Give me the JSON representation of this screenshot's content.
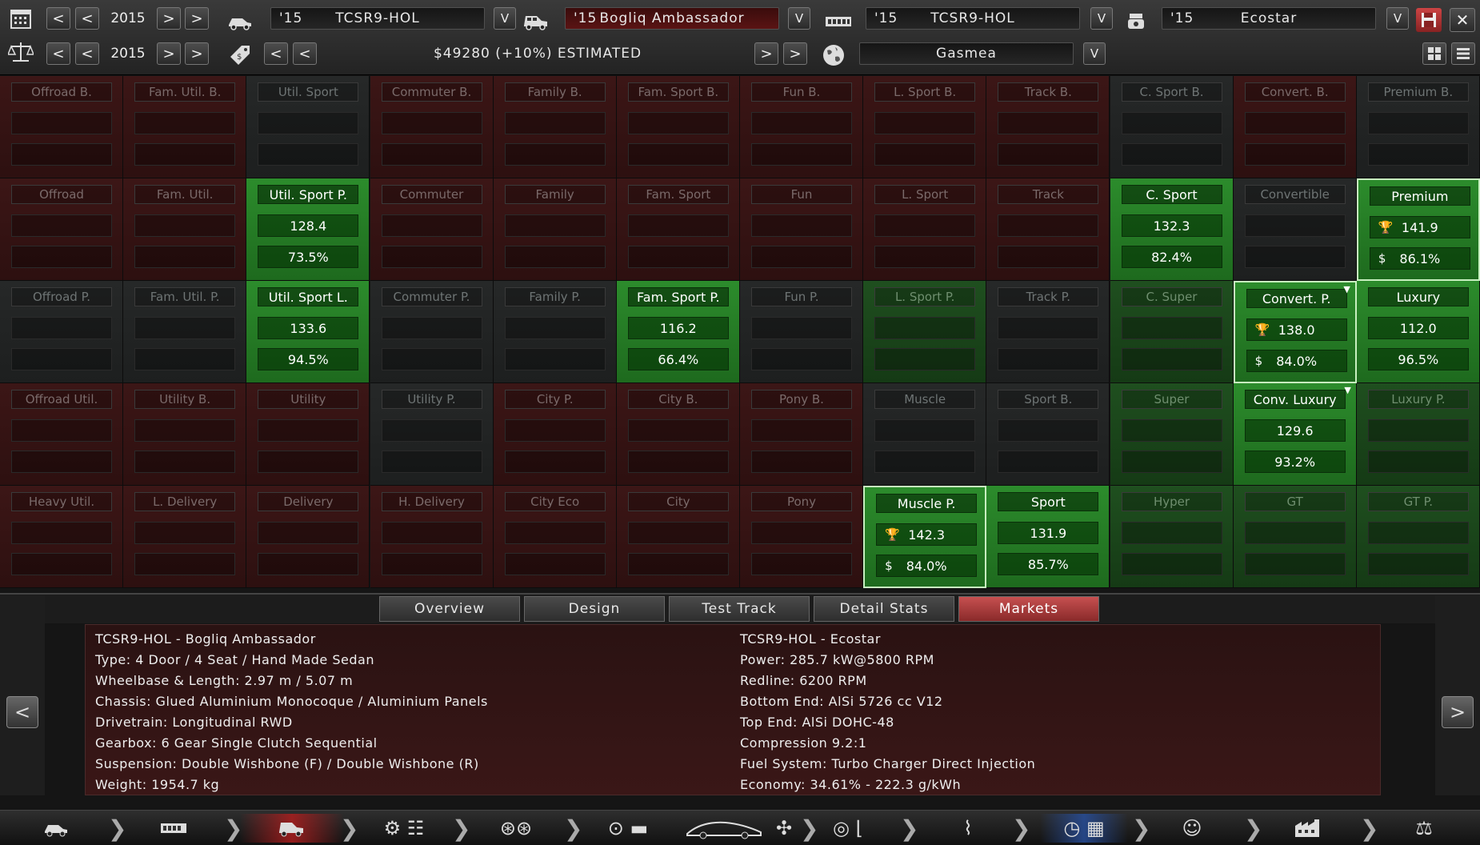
{
  "top": {
    "row1": {
      "year": "2015",
      "body": {
        "prefix": "'15",
        "name": "TCSR9-HOL"
      },
      "model": {
        "prefix": "'15",
        "name": "Bogliq Ambassador"
      },
      "engine": {
        "prefix": "'15",
        "name": "TCSR9-HOL"
      },
      "variant": {
        "prefix": "'15",
        "name": "Ecostar"
      }
    },
    "row2": {
      "year": "2015",
      "price": "$49280 (+10%) ESTIMATED",
      "country": "Gasmea"
    },
    "dropdown_glyph": "V",
    "left_glyph": "<",
    "right_glyph": ">"
  },
  "markets": [
    [
      {
        "label": "Offroad B.",
        "s": "r"
      },
      {
        "label": "Fam. Util. B.",
        "s": "r"
      },
      {
        "label": "Util. Sport",
        "s": "n"
      },
      {
        "label": "Commuter B.",
        "s": "r"
      },
      {
        "label": "Family B.",
        "s": "r"
      },
      {
        "label": "Fam. Sport B.",
        "s": "r"
      },
      {
        "label": "Fun B.",
        "s": "r"
      },
      {
        "label": "L. Sport B.",
        "s": "r"
      },
      {
        "label": "Track B.",
        "s": "r"
      },
      {
        "label": "C. Sport B.",
        "s": "n"
      },
      {
        "label": "Convert. B.",
        "s": "r"
      },
      {
        "label": "Premium B.",
        "s": "n"
      }
    ],
    [
      {
        "label": "Offroad",
        "s": "r"
      },
      {
        "label": "Fam. Util.",
        "s": "r"
      },
      {
        "label": "Util. Sport P.",
        "s": "G",
        "v1": "128.4",
        "v2": "73.5%"
      },
      {
        "label": "Commuter",
        "s": "r"
      },
      {
        "label": "Family",
        "s": "r"
      },
      {
        "label": "Fam. Sport",
        "s": "r"
      },
      {
        "label": "Fun",
        "s": "r"
      },
      {
        "label": "L. Sport",
        "s": "r"
      },
      {
        "label": "Track",
        "s": "r"
      },
      {
        "label": "C. Sport",
        "s": "G",
        "v1": "132.3",
        "v2": "82.4%"
      },
      {
        "label": "Convertible",
        "s": "n"
      },
      {
        "label": "Premium",
        "s": "G",
        "v1": "141.9",
        "v2": "86.1%",
        "icons": true,
        "sel": true
      }
    ],
    [
      {
        "label": "Offroad P.",
        "s": "n"
      },
      {
        "label": "Fam. Util. P.",
        "s": "n"
      },
      {
        "label": "Util. Sport L.",
        "s": "G",
        "v1": "133.6",
        "v2": "94.5%"
      },
      {
        "label": "Commuter P.",
        "s": "n"
      },
      {
        "label": "Family P.",
        "s": "n"
      },
      {
        "label": "Fam. Sport P.",
        "s": "G",
        "v1": "116.2",
        "v2": "66.4%"
      },
      {
        "label": "Fun P.",
        "s": "n"
      },
      {
        "label": "L. Sport P.",
        "s": "g"
      },
      {
        "label": "Track P.",
        "s": "n"
      },
      {
        "label": "C. Super",
        "s": "g"
      },
      {
        "label": "Convert. P.",
        "s": "G",
        "v1": "138.0",
        "v2": "84.0%",
        "icons": true,
        "sel": true,
        "pin": true
      },
      {
        "label": "Luxury",
        "s": "G",
        "v1": "112.0",
        "v2": "96.5%"
      }
    ],
    [
      {
        "label": "Offroad Util.",
        "s": "r"
      },
      {
        "label": "Utility B.",
        "s": "r"
      },
      {
        "label": "Utility",
        "s": "r"
      },
      {
        "label": "Utility P.",
        "s": "n"
      },
      {
        "label": "City P.",
        "s": "r"
      },
      {
        "label": "City B.",
        "s": "r"
      },
      {
        "label": "Pony B.",
        "s": "r"
      },
      {
        "label": "Muscle",
        "s": "n"
      },
      {
        "label": "Sport B.",
        "s": "n"
      },
      {
        "label": "Super",
        "s": "g"
      },
      {
        "label": "Conv. Luxury",
        "s": "G",
        "v1": "129.6",
        "v2": "93.2%",
        "pin": true
      },
      {
        "label": "Luxury P.",
        "s": "g"
      }
    ],
    [
      {
        "label": "Heavy Util.",
        "s": "r"
      },
      {
        "label": "L. Delivery",
        "s": "r"
      },
      {
        "label": "Delivery",
        "s": "r"
      },
      {
        "label": "H. Delivery",
        "s": "r"
      },
      {
        "label": "City Eco",
        "s": "r"
      },
      {
        "label": "City",
        "s": "r"
      },
      {
        "label": "Pony",
        "s": "r"
      },
      {
        "label": "Muscle P.",
        "s": "G",
        "v1": "142.3",
        "v2": "84.0%",
        "icons": true,
        "sel": true
      },
      {
        "label": "Sport",
        "s": "G",
        "v1": "131.9",
        "v2": "85.7%"
      },
      {
        "label": "Hyper",
        "s": "g"
      },
      {
        "label": "GT",
        "s": "g"
      },
      {
        "label": "GT P.",
        "s": "g"
      }
    ]
  ],
  "tabs": [
    "Overview",
    "Design",
    "Test Track",
    "Detail Stats",
    "Markets"
  ],
  "active_tab": "Markets",
  "info": {
    "left": [
      "TCSR9-HOL - Bogliq Ambassador",
      "Type: 4 Door / 4 Seat / Hand Made Sedan",
      "Wheelbase & Length: 2.97 m / 5.07 m",
      "Chassis: Glued Aluminium Monocoque / Aluminium Panels",
      "Drivetrain: Longitudinal RWD",
      "Gearbox: 6 Gear Single Clutch Sequential",
      "Suspension: Double Wishbone (F) / Double Wishbone (R)",
      "Weight: 1954.7 kg"
    ],
    "right": [
      "TCSR9-HOL - Ecostar",
      "Power: 285.7 kW@5800 RPM",
      "Redline: 6200 RPM",
      "Bottom End: AlSi 5726 cc V12",
      "Top End: AlSi DOHC-48",
      "Compression 9.2:1",
      "Fuel System: Turbo Charger Direct Injection",
      "Economy: 34.61% - 222.3 g/kWh"
    ]
  },
  "icons": {
    "trophy": "🏆",
    "dollar": "$",
    "pin": "📌"
  },
  "bottom_icons": [
    "car-body-icon",
    "engine-icon",
    "model-icon",
    "gearbox-icon",
    "wheels-icon",
    "fixtures-icon",
    "aero-icon",
    "interior-icon",
    "suspension-icon",
    "testing-icon",
    "engineer-icon",
    "factory-icon",
    "compare-icon"
  ],
  "colors": {
    "red_cell": "#3c1616",
    "neutral_cell": "#262828",
    "dim_green": "#1f4f1f",
    "bright_green": "#2c8c2c",
    "active_tab": "#c65050"
  }
}
